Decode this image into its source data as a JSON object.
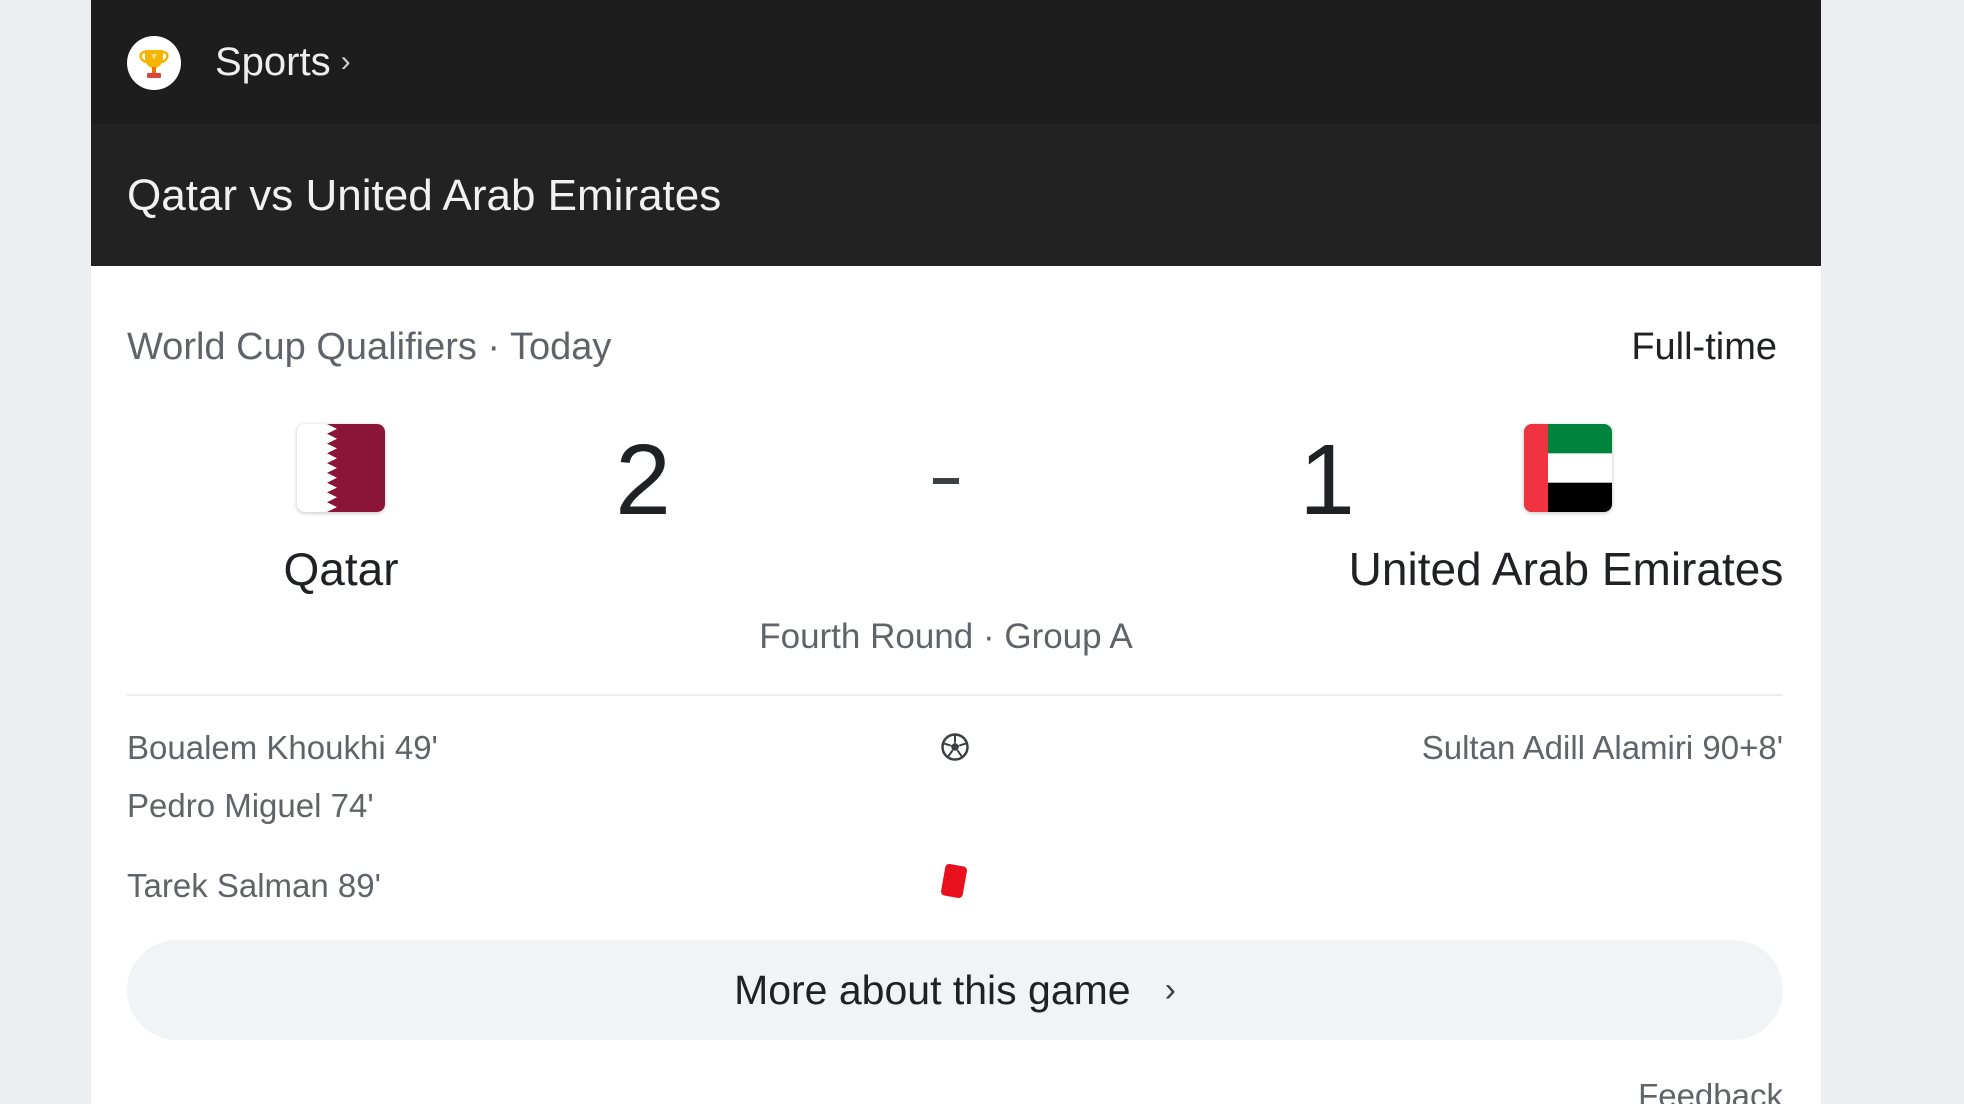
{
  "header": {
    "section_label": "Sports",
    "section_chevron": "›",
    "section_icon": "trophy-icon",
    "match_title": "Qatar vs United Arab Emirates"
  },
  "match": {
    "competition_line": "World Cup Qualifiers · Today",
    "status": "Full-time",
    "home": {
      "name": "Qatar",
      "score": "2",
      "flag_colors": [
        "#ffffff",
        "#8a1538"
      ]
    },
    "away": {
      "name": "United Arab Emirates",
      "score": "1",
      "flag_colors": [
        "#ef3340",
        "#00843d",
        "#ffffff",
        "#000000"
      ]
    },
    "round": "Fourth Round · Group A"
  },
  "events": {
    "goals_icon": "soccer-ball-icon",
    "home_goals": [
      "Boualem Khoukhi 49'",
      "Pedro Miguel 74'"
    ],
    "away_goals": [
      "Sultan Adill Alamiri 90+8'"
    ],
    "red_card_icon": "red-card-icon",
    "red_card_color": "#e8101c",
    "home_red_cards": [
      "Tarek Salman 89'"
    ]
  },
  "actions": {
    "more_label": "More about this game",
    "more_chevron": "›",
    "feedback_label": "Feedback"
  }
}
